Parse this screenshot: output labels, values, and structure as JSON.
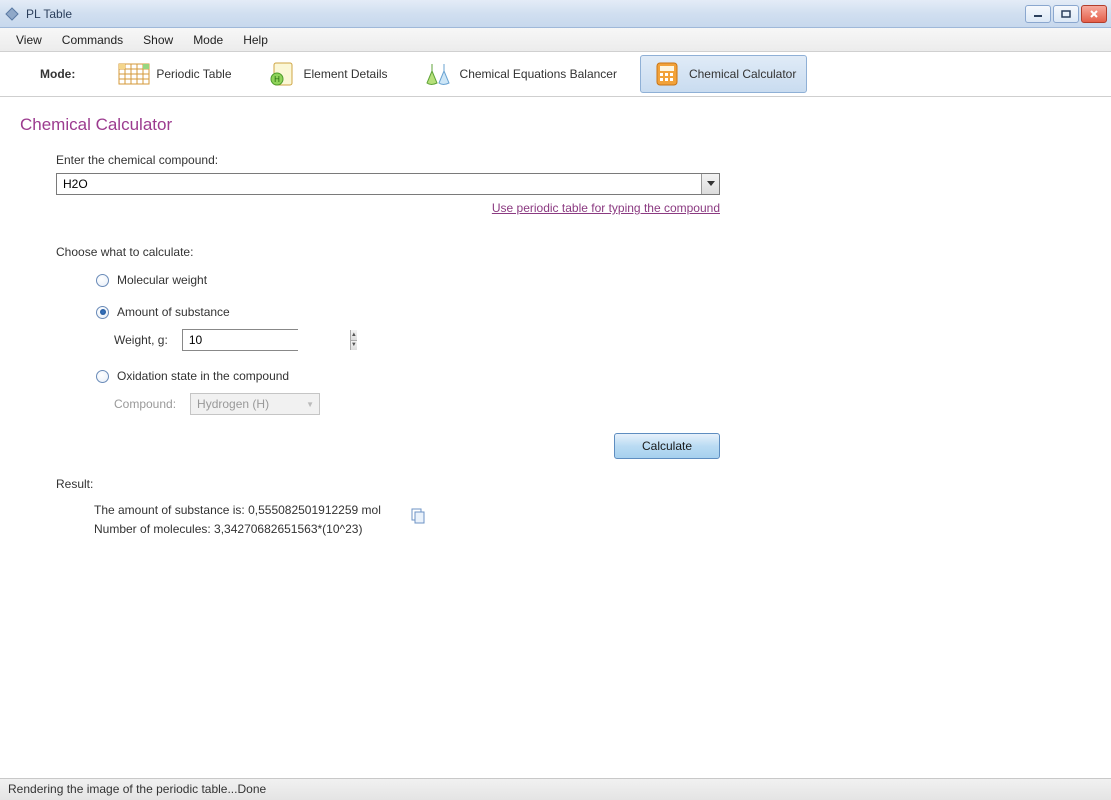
{
  "window": {
    "title": "PL Table"
  },
  "menu": {
    "items": [
      "View",
      "Commands",
      "Show",
      "Mode",
      "Help"
    ]
  },
  "toolbar": {
    "mode_label": "Mode:",
    "items": [
      {
        "label": "Periodic Table",
        "active": false
      },
      {
        "label": "Element Details",
        "active": false
      },
      {
        "label": "Chemical Equations Balancer",
        "active": false
      },
      {
        "label": "Chemical Calculator",
        "active": true
      }
    ]
  },
  "page": {
    "title": "Chemical Calculator",
    "compound_label": "Enter the chemical compound:",
    "compound_value": "H2O",
    "helper_link": "Use periodic table for typing the compound",
    "choose_label": "Choose what to calculate:",
    "options": {
      "molecular_weight": "Molecular weight",
      "amount_of_substance": "Amount of substance",
      "weight_label": "Weight, g:",
      "weight_value": "10",
      "oxidation_state": "Oxidation state in the compound",
      "compound_sub_label": "Compound:",
      "compound_sub_value": "Hydrogen (H)"
    },
    "calculate_button": "Calculate",
    "result_label": "Result:",
    "result_line1": "The amount of substance is: 0,555082501912259 mol",
    "result_line2": "Number of molecules: 3,34270682651563*(10^23)"
  },
  "statusbar": {
    "text": "Rendering the image of the periodic table...Done"
  }
}
